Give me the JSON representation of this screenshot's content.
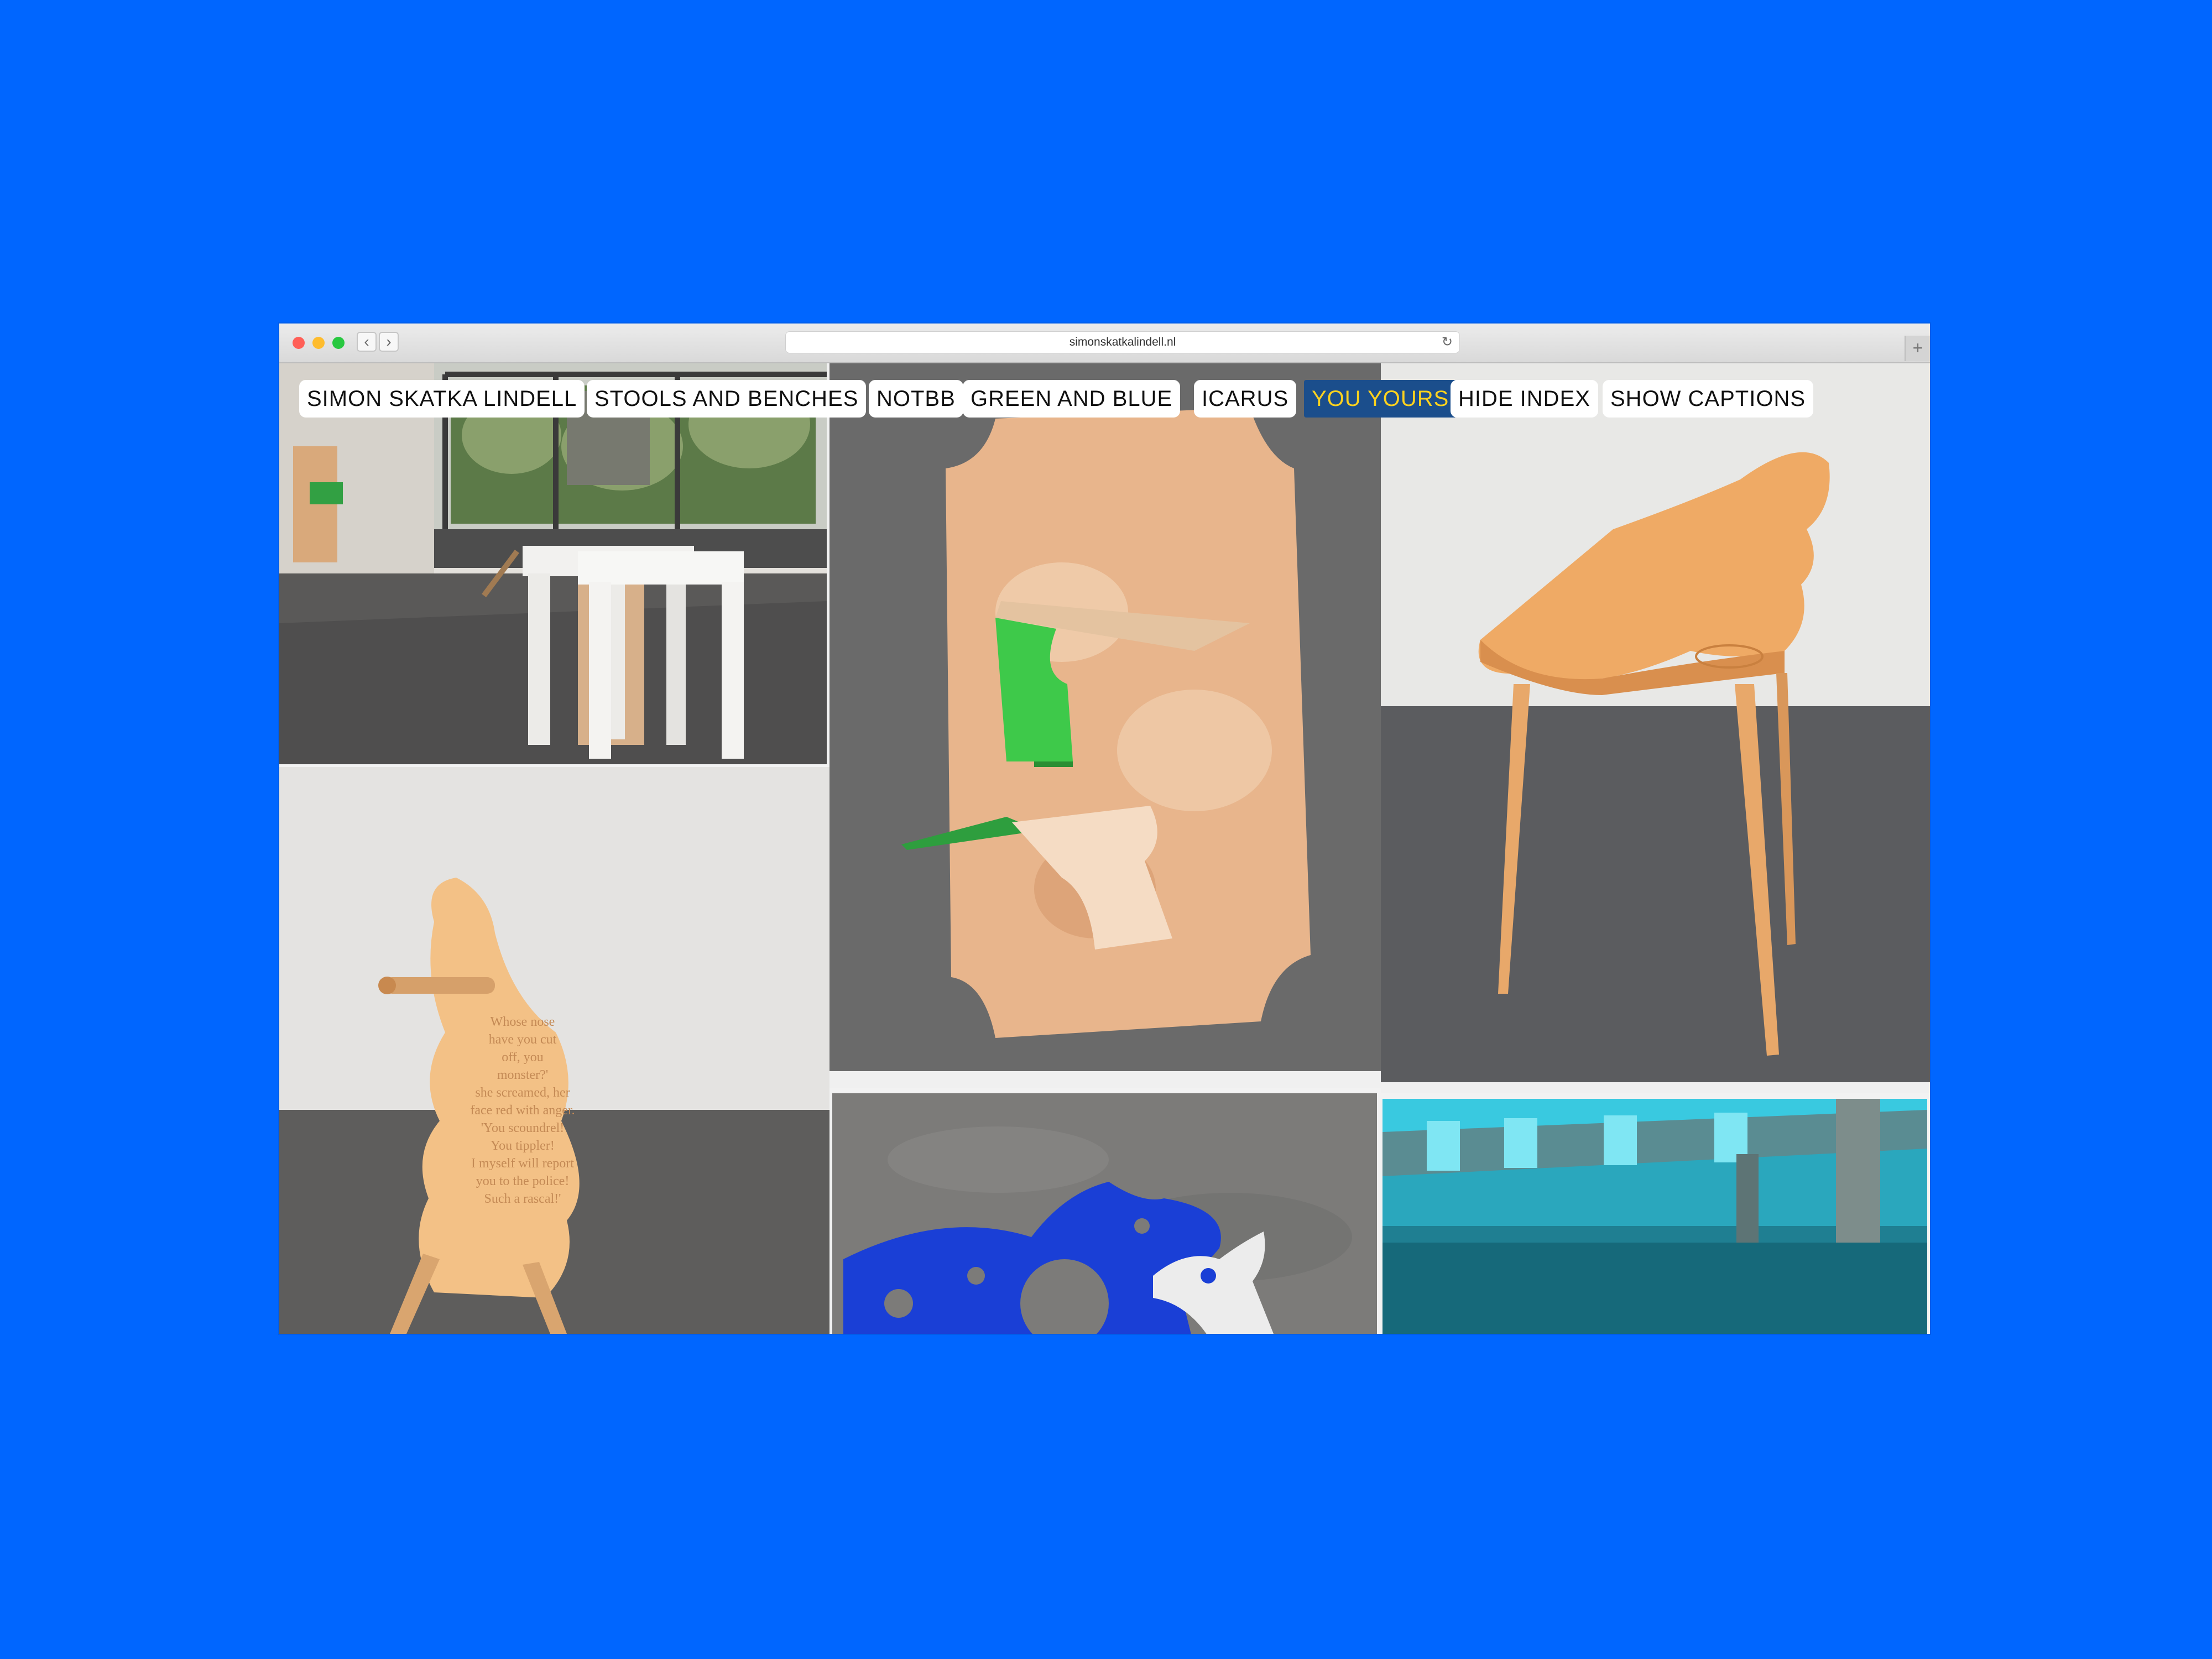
{
  "browser": {
    "url": "simonskatkalindell.nl",
    "back_icon": "‹",
    "forward_icon": "›",
    "reload_icon": "↻",
    "new_tab_icon": "+"
  },
  "nav": {
    "items": [
      {
        "label": "SIMON SKATKA LINDELL",
        "active": false
      },
      {
        "label": "STOOLS AND BENCHES",
        "active": false
      },
      {
        "label": "NOTBB",
        "active": false
      },
      {
        "label": "GREEN AND BLUE",
        "active": false
      },
      {
        "label": "ICARUS",
        "active": false
      },
      {
        "label": "YOU YOURS",
        "active": true
      },
      {
        "label": "HIDE INDEX",
        "active": false
      },
      {
        "label": "SHOW CAPTIONS",
        "active": false
      }
    ],
    "active_bg": "#1b4e8c",
    "active_fg": "#ffd21e"
  },
  "poem": {
    "lines": [
      "Whose nose",
      "have you cut",
      "off, you",
      "monster?'",
      "she screamed, her",
      "face red with anger.",
      "'You scoundrel!",
      "You tippler!",
      "I myself will report",
      "you to the police!",
      "Such a rascal!'"
    ]
  },
  "colors": {
    "page_bg": "#0066ff",
    "wood": "#f0b679",
    "green_panel": "#3ec94a",
    "blue_cutout": "#1a3fd6",
    "cyan_light": "#39c9e0"
  }
}
